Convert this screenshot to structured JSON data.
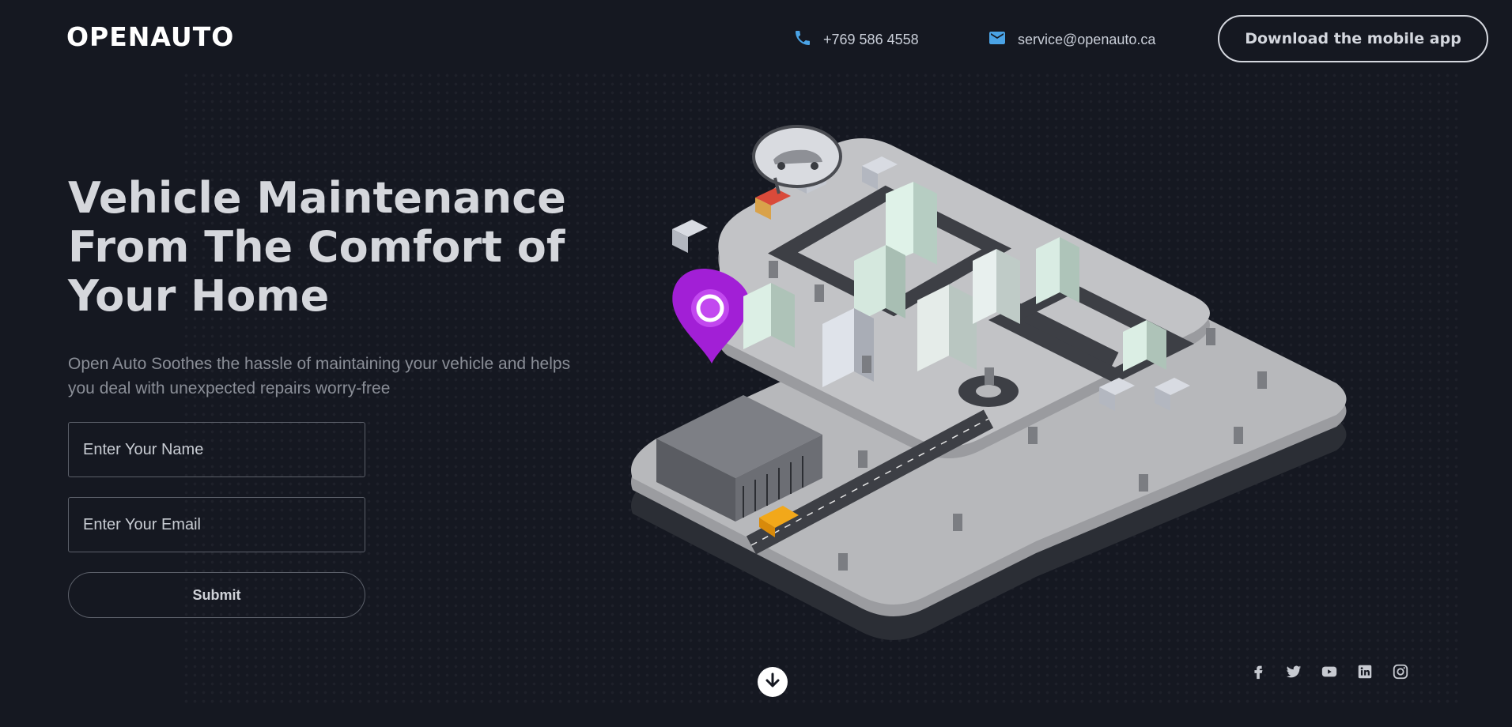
{
  "header": {
    "logo_text": "OPENAUTO",
    "phone": "+769 586 4558",
    "email": "service@openauto.ca",
    "download_button": "Download the mobile app"
  },
  "hero": {
    "headline_line1": "Vehicle Maintenance",
    "headline_line2": "From The Comfort of",
    "headline_line3": "Your Home",
    "subtitle_line1": "Open Auto Soothes the hassle of maintaining your vehicle and helps",
    "subtitle_line2": "you deal with unexpected repairs worry-free"
  },
  "form": {
    "name_placeholder": "Enter Your Name",
    "email_placeholder": "Enter Your Email",
    "submit_label": "Submit"
  },
  "icons": {
    "phone": "phone-icon",
    "mail": "mail-icon",
    "scroll": "arrow-down-icon",
    "socials": [
      "facebook-icon",
      "twitter-icon",
      "youtube-icon",
      "linkedin-icon",
      "instagram-icon"
    ]
  },
  "colors": {
    "background": "#151821",
    "accent_pin": "#a21fd6",
    "contact_icon": "#4aa3e6",
    "text_primary": "#d5d7dc",
    "text_muted": "#8a8e97"
  }
}
